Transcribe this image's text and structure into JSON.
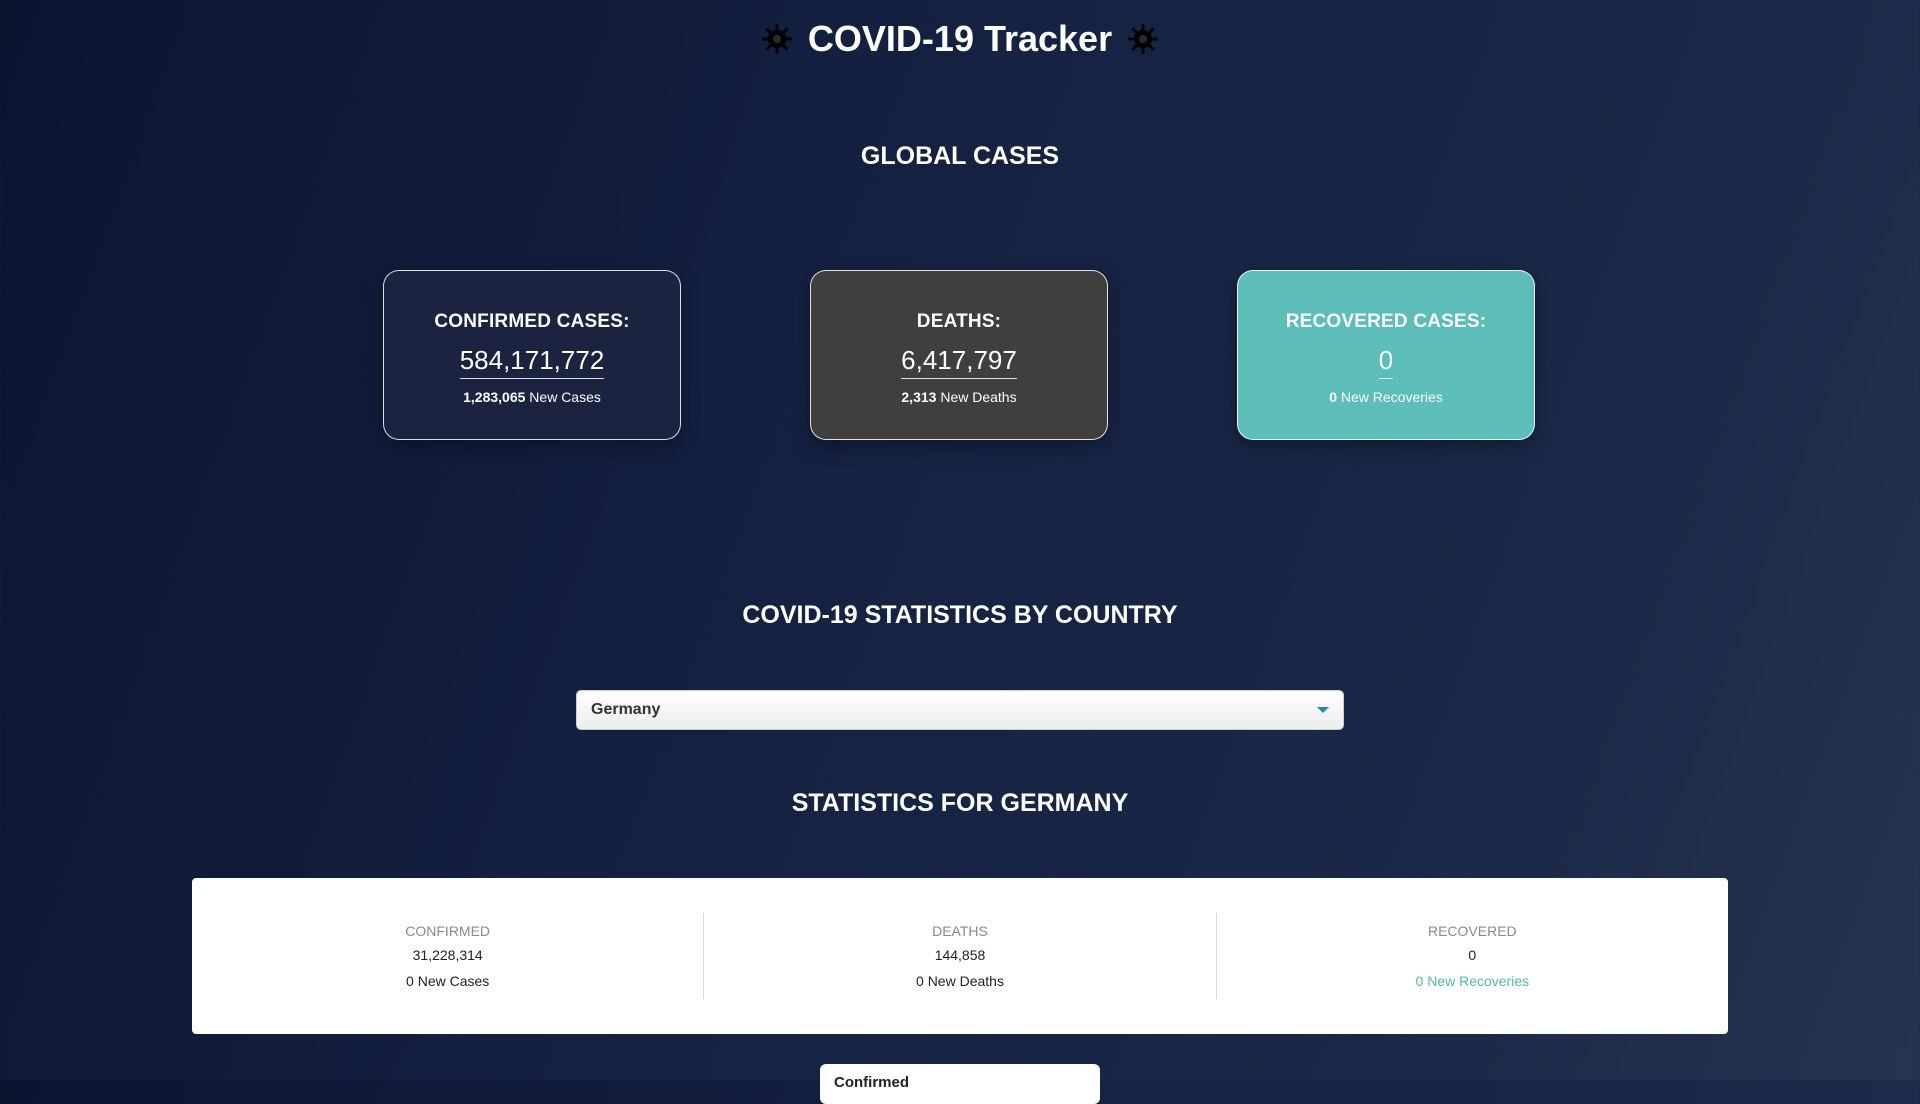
{
  "header": {
    "title": "COVID-19 Tracker",
    "left_icon": "virus-icon",
    "right_icon": "virus-icon"
  },
  "global": {
    "heading": "GLOBAL CASES",
    "confirmed": {
      "label": "CONFIRMED CASES:",
      "value": "584,171,772",
      "new_value": "1,283,065",
      "new_label": "New Cases"
    },
    "deaths": {
      "label": "DEATHS:",
      "value": "6,417,797",
      "new_value": "2,313",
      "new_label": "New Deaths"
    },
    "recovered": {
      "label": "RECOVERED CASES:",
      "value": "0",
      "new_value": "0",
      "new_label": "New Recoveries"
    }
  },
  "by_country": {
    "heading": "COVID-19 STATISTICS BY COUNTRY",
    "selected_country": "Germany"
  },
  "country_stats": {
    "heading": "STATISTICS FOR GERMANY",
    "confirmed": {
      "label": "CONFIRMED",
      "value": "31,228,314",
      "new": "0 New Cases"
    },
    "deaths": {
      "label": "DEATHS",
      "value": "144,858",
      "new": "0 New Deaths"
    },
    "recovered": {
      "label": "RECOVERED",
      "value": "0",
      "new": "0 New Recoveries"
    }
  },
  "chart_select": {
    "value": "Confirmed"
  },
  "colors": {
    "confirmed_card": "#1b2341",
    "deaths_card": "#413f3e",
    "recovered_card": "#5dbdb9",
    "accent_teal": "#4fb8b4"
  }
}
